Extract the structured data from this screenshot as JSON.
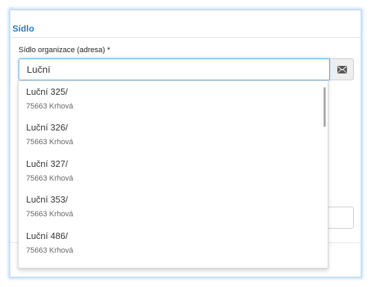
{
  "page": {
    "marker": "."
  },
  "section": {
    "title": "Sídlo"
  },
  "address_field": {
    "label": "Sídlo organizace (adresa) *",
    "value": "Luční",
    "button_icon": "envelope-icon"
  },
  "suggestions": [
    {
      "street": "Luční 325/",
      "city": "75663 Krhová"
    },
    {
      "street": "Luční 326/",
      "city": "75663 Krhová"
    },
    {
      "street": "Luční 327/",
      "city": "75663 Krhová"
    },
    {
      "street": "Luční 353/",
      "city": "75663 Krhová"
    },
    {
      "street": "Luční 486/",
      "city": "75663 Krhová"
    }
  ],
  "colors": {
    "title": "#2f7bbf",
    "focus_border": "#66afe9",
    "frame_glow": "#b9d6ee",
    "addon_bg": "#eeeeee"
  }
}
